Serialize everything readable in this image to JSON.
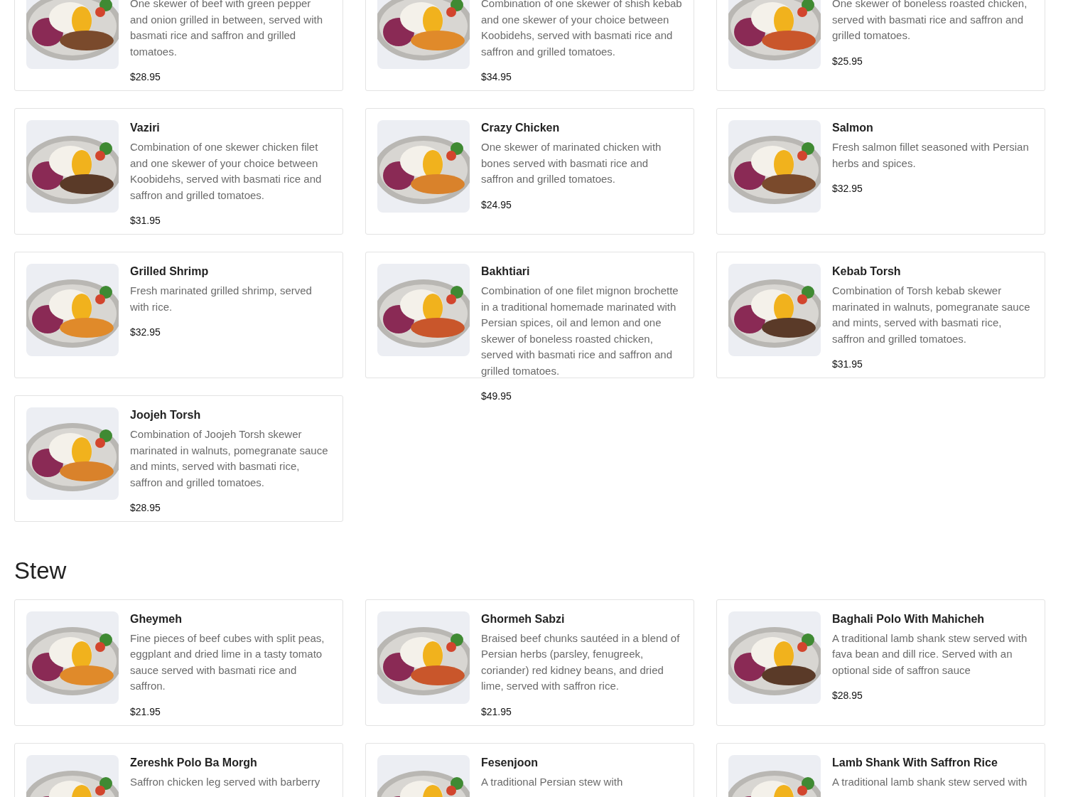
{
  "sections": [
    {
      "items": [
        {
          "description": "One skewer of beef with green pepper and onion grilled in between, served with basmati rice and saffron and grilled tomatoes.",
          "price": "$28.95"
        },
        {
          "description": "Combination of one skewer of shish kebab and one skewer of your choice between Koobidehs, served with basmati rice and saffron and grilled tomatoes.",
          "price": "$34.95"
        },
        {
          "description": "One skewer of boneless roasted chicken, served with basmati rice and saffron and grilled tomatoes.",
          "price": "$25.95"
        },
        {
          "name": "Vaziri",
          "description": "Combination of one skewer chicken filet and one skewer of your choice between Koobidehs, served with basmati rice and saffron and grilled tomatoes.",
          "price": "$31.95"
        },
        {
          "name": "Crazy Chicken",
          "description": "One skewer of marinated chicken with bones served with basmati rice and saffron and grilled tomatoes.",
          "price": "$24.95"
        },
        {
          "name": "Salmon",
          "description": "Fresh salmon fillet seasoned with Persian herbs and spices.",
          "price": "$32.95"
        },
        {
          "name": "Grilled Shrimp",
          "description": "Fresh marinated grilled shrimp, served with rice.",
          "price": "$32.95"
        },
        {
          "name": "Bakhtiari",
          "description": "Combination of one filet mignon brochette in a traditional homemade marinated with Persian spices, oil and lemon and one skewer of boneless roasted chicken, served with basmati rice and saffron and grilled tomatoes.",
          "price": "$49.95"
        },
        {
          "name": "Kebab Torsh",
          "description": "Combination of Torsh kebab skewer marinated in walnuts, pomegranate sauce and mints, served with basmati rice, saffron and grilled tomatoes.",
          "price": "$31.95"
        },
        {
          "name": "Joojeh Torsh",
          "description": "Combination of Joojeh Torsh skewer marinated in walnuts, pomegranate sauce and mints, served with basmati rice, saffron and grilled tomatoes.",
          "price": "$28.95"
        }
      ]
    },
    {
      "title": "Stew",
      "items": [
        {
          "name": "Gheymeh",
          "description": "Fine pieces of beef cubes with split peas, eggplant and dried lime in a tasty tomato sauce served with basmati rice and saffron.",
          "price": "$21.95"
        },
        {
          "name": "Ghormeh Sabzi",
          "description": "Braised beef chunks sautéed in a blend of Persian herbs (parsley, fenugreek, coriander) red kidney beans, and dried lime, served with saffron rice.",
          "price": "$21.95"
        },
        {
          "name": "Baghali Polo With Mahicheh",
          "description": "A traditional lamb shank stew served with fava bean and dill rice. Served with an optional side of saffron sauce",
          "price": "$28.95"
        },
        {
          "name": "Zereshk Polo Ba Morgh",
          "description": "Saffron chicken leg served with barberry"
        },
        {
          "name": "Fesenjoon",
          "description": "A traditional Persian stew with"
        },
        {
          "name": "Lamb Shank With Saffron Rice",
          "description": "A traditional lamb shank stew served with"
        }
      ]
    }
  ]
}
